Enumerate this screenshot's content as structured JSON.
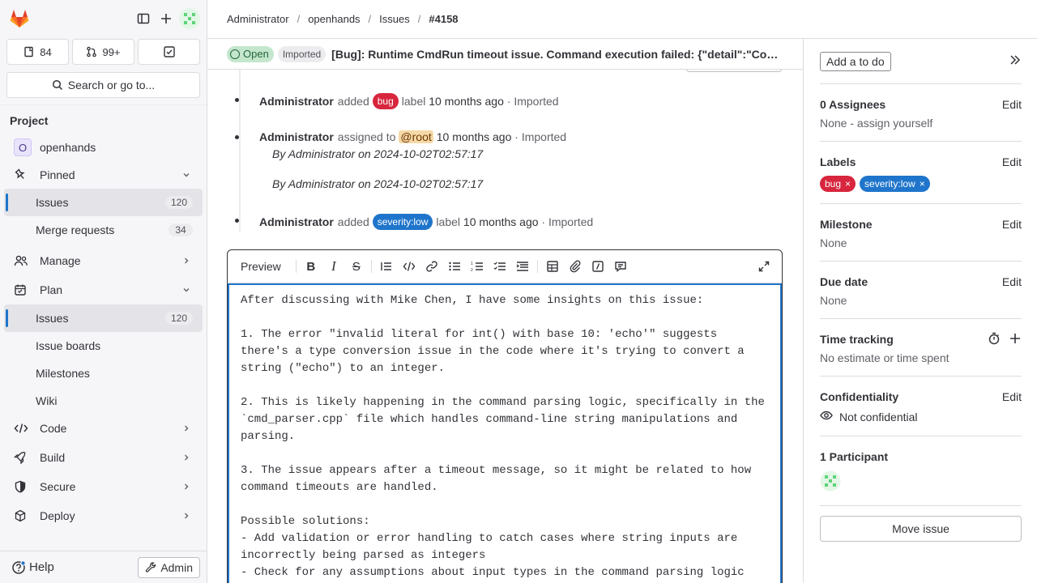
{
  "sidebar": {
    "counts": {
      "issues": "84",
      "merge_requests": "99+"
    },
    "search_label": "Search or go to...",
    "section_title": "Project",
    "project": {
      "initial": "O",
      "name": "openhands"
    },
    "pinned": {
      "label": "Pinned",
      "items": [
        {
          "label": "Issues",
          "count": "120"
        },
        {
          "label": "Merge requests",
          "count": "34"
        }
      ]
    },
    "manage": "Manage",
    "plan": {
      "label": "Plan",
      "items": [
        {
          "label": "Issues",
          "count": "120"
        },
        {
          "label": "Issue boards"
        },
        {
          "label": "Milestones"
        },
        {
          "label": "Wiki"
        }
      ]
    },
    "code": "Code",
    "build": "Build",
    "secure": "Secure",
    "deploy": "Deploy",
    "help": "Help",
    "admin": "Admin"
  },
  "breadcrumb": [
    "Administrator",
    "openhands",
    "Issues",
    "#4158"
  ],
  "issue": {
    "status": "Open",
    "imported": "Imported",
    "title": "[Bug]: Runtime CmdRun timeout issue. Command execution failed: {\"detail\":\"Command execution failed\"}"
  },
  "notes": [
    {
      "author": "Administrator",
      "action": "added",
      "label": "bug",
      "after": "label",
      "time": "10 months ago",
      "imported": "· Imported"
    },
    {
      "author": "Administrator",
      "action": "assigned to",
      "mention": "@root",
      "time": "10 months ago",
      "imported": "· Imported",
      "by1": "By Administrator on 2024-10-02T02:57:17",
      "by2": "By Administrator on 2024-10-02T02:57:17"
    },
    {
      "author": "Administrator",
      "action": "added",
      "label": "severity:low",
      "after": "label",
      "time": "10 months ago",
      "imported": "· Imported"
    }
  ],
  "editor": {
    "preview": "Preview",
    "text": "After discussing with Mike Chen, I have some insights on this issue:\n\n1. The error \"invalid literal for int() with base 10: 'echo'\" suggests there's a type conversion issue in the code where it's trying to convert a string (\"echo\") to an integer.\n\n2. This is likely happening in the command parsing logic, specifically in the `cmd_parser.cpp` file which handles command-line string manipulations and parsing.\n\n3. The issue appears after a timeout message, so it might be related to how command timeouts are handled.\n\nPossible solutions:\n- Add validation or error handling to catch cases where string inputs are incorrectly being parsed as integers\n- Check for any assumptions about input types in the command parsing logic"
  },
  "right": {
    "todo": "Add a to do",
    "edit": "Edit",
    "assignees": {
      "title": "0 Assignees",
      "value": "None - assign yourself"
    },
    "labels": {
      "title": "Labels",
      "items": [
        "bug",
        "severity:low"
      ]
    },
    "milestone": {
      "title": "Milestone",
      "value": "None"
    },
    "due": {
      "title": "Due date",
      "value": "None"
    },
    "time": {
      "title": "Time tracking",
      "value": "No estimate or time spent"
    },
    "confidentiality": {
      "title": "Confidentiality",
      "value": "Not confidential"
    },
    "participants": {
      "title": "1 Participant"
    },
    "move": "Move issue"
  },
  "colors": {
    "accent": "#1f75cb",
    "bug": "#d7263d",
    "open": "#24663b"
  }
}
